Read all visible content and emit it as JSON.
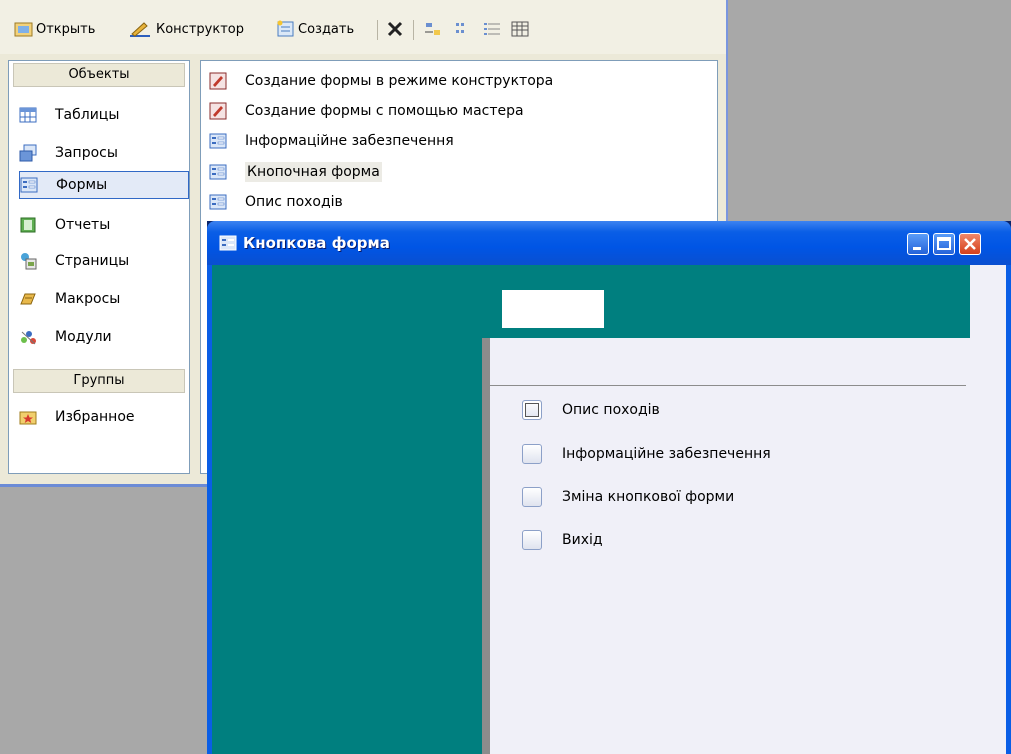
{
  "toolbar": {
    "open_label": "Открыть",
    "designer_label": "Конструктор",
    "create_label": "Создать"
  },
  "objects": {
    "header": "Объекты",
    "items": [
      "Таблицы",
      "Запросы",
      "Формы",
      "Отчеты",
      "Страницы",
      "Макросы",
      "Модули"
    ],
    "selected": "Формы",
    "groups_header": "Группы",
    "groups_items": [
      "Избранное"
    ]
  },
  "list": {
    "items": [
      "Создание формы в режиме конструктора",
      "Создание формы с помощью мастера",
      "Інформаційне забезпечення",
      "Кнопочная форма",
      "Опис походів"
    ]
  },
  "form_window": {
    "title": "Кнопкова форма",
    "switchboard_items": [
      "Опис походів",
      "Інформаційне забезпечення",
      "Зміна кнопкової форми",
      "Вихід"
    ]
  },
  "colors": {
    "teal": "#007f7f",
    "titlebar": "#0055e5",
    "selection_border": "#3169c6"
  }
}
